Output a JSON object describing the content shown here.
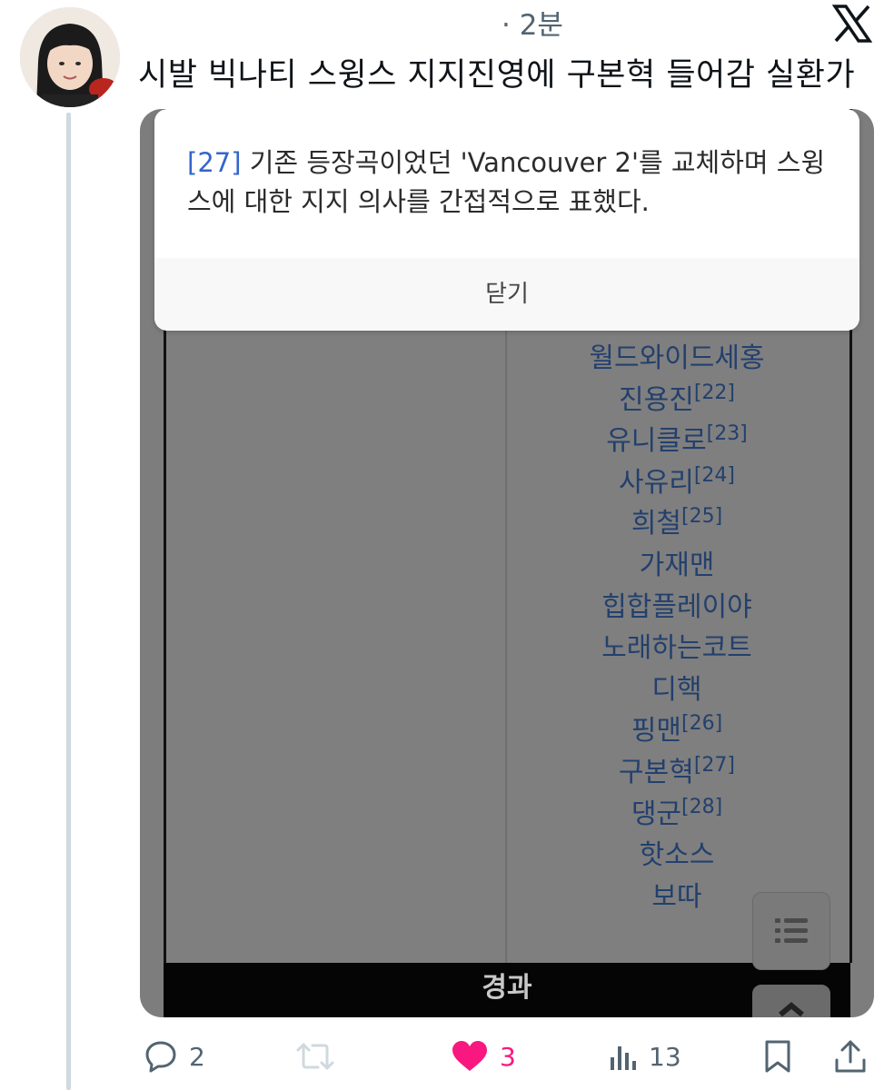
{
  "tweet": {
    "time": "· 2분",
    "text": "시발 빅나티 스윙스 지지진영에 구본혁 들어감 실환가"
  },
  "media": {
    "popup": {
      "ref": "[27]",
      "body_line1": " 기존 등장곡이었던 'Vancouver 2'를 교체하며 스윙",
      "body_line2": "스에 대한 지지 의사를 간접적으로 표했다.",
      "close_label": "닫기"
    },
    "list": [
      {
        "name": "월드와이드세홍",
        "ref": ""
      },
      {
        "name": "진용진",
        "ref": "[22]"
      },
      {
        "name": "유니클로",
        "ref": "[23]"
      },
      {
        "name": "사유리",
        "ref": "[24]"
      },
      {
        "name": "희철",
        "ref": "[25]"
      },
      {
        "name": "가재맨",
        "ref": ""
      },
      {
        "name": "힙합플레이야",
        "ref": ""
      },
      {
        "name": "노래하는코트",
        "ref": ""
      },
      {
        "name": "디핵",
        "ref": ""
      },
      {
        "name": "핑맨",
        "ref": "[26]"
      },
      {
        "name": "구본혁",
        "ref": "[27]"
      },
      {
        "name": "댕군",
        "ref": "[28]"
      },
      {
        "name": "핫소스",
        "ref": ""
      },
      {
        "name": "보따",
        "ref": ""
      }
    ],
    "bottom_label": "경과"
  },
  "actions": {
    "reply_count": "2",
    "retweet_count": "",
    "like_count": "3",
    "views_count": "13"
  },
  "icons": [
    "x-logo-icon",
    "reply-icon",
    "retweet-icon",
    "heart-icon",
    "views-icon",
    "bookmark-icon",
    "share-icon",
    "list-icon",
    "chevron-up-icon"
  ],
  "colors": {
    "like": "#f91880",
    "link": "#3366cc",
    "muted": "#536471"
  }
}
